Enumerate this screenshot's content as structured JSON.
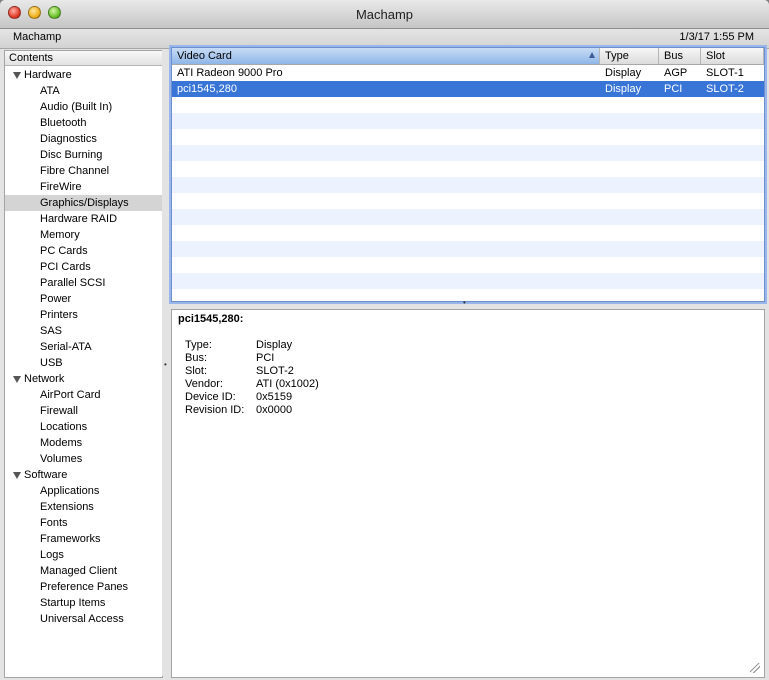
{
  "window": {
    "title": "Machamp"
  },
  "infobar": {
    "host": "Machamp",
    "datetime": "1/3/17 1:55 PM"
  },
  "sidebar": {
    "header": "Contents",
    "groups": [
      {
        "label": "Hardware",
        "children": [
          "ATA",
          "Audio (Built In)",
          "Bluetooth",
          "Diagnostics",
          "Disc Burning",
          "Fibre Channel",
          "FireWire",
          "Graphics/Displays",
          "Hardware RAID",
          "Memory",
          "PC Cards",
          "PCI Cards",
          "Parallel SCSI",
          "Power",
          "Printers",
          "SAS",
          "Serial-ATA",
          "USB"
        ]
      },
      {
        "label": "Network",
        "children": [
          "AirPort Card",
          "Firewall",
          "Locations",
          "Modems",
          "Volumes"
        ]
      },
      {
        "label": "Software",
        "children": [
          "Applications",
          "Extensions",
          "Fonts",
          "Frameworks",
          "Logs",
          "Managed Client",
          "Preference Panes",
          "Startup Items",
          "Universal Access"
        ]
      }
    ],
    "selected": "Graphics/Displays"
  },
  "table": {
    "columns": [
      "Video Card",
      "Type",
      "Bus",
      "Slot"
    ],
    "rows": [
      [
        "ATI Radeon 9000 Pro",
        "Display",
        "AGP",
        "SLOT-1"
      ],
      [
        "pci1545,280",
        "Display",
        "PCI",
        "SLOT-2"
      ]
    ],
    "selected_row": 1,
    "sorted_column": "Video Card"
  },
  "detail": {
    "title": "pci1545,280:",
    "properties": [
      {
        "key": "Type:",
        "value": "Display"
      },
      {
        "key": "Bus:",
        "value": "PCI"
      },
      {
        "key": "Slot:",
        "value": "SLOT-2"
      },
      {
        "key": "Vendor:",
        "value": "ATI (0x1002)"
      },
      {
        "key": "Device ID:",
        "value": "0x5159"
      },
      {
        "key": "Revision ID:",
        "value": "0x0000"
      }
    ]
  },
  "colors": {
    "selection": "#3875d7",
    "stripe": "#edf3fe",
    "sidebar_selection": "#d4d4d4"
  },
  "icons": [
    "close-button-icon",
    "minimize-button-icon",
    "zoom-button-icon",
    "disclosure-triangle-icon",
    "sort-ascending-icon",
    "resize-grip-icon"
  ]
}
